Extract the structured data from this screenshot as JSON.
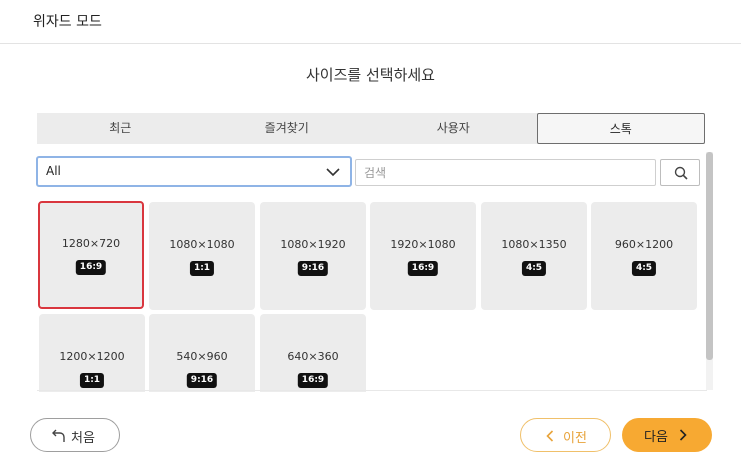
{
  "window": {
    "title": "위자드 모드"
  },
  "heading": "사이즈를 선택하세요",
  "tabs": [
    {
      "label": "최근",
      "active": false
    },
    {
      "label": "즐겨찾기",
      "active": false
    },
    {
      "label": "사용자",
      "active": false
    },
    {
      "label": "스톡",
      "active": true
    }
  ],
  "filter": {
    "selected": "All"
  },
  "search": {
    "placeholder": "검색",
    "value": ""
  },
  "sizes": [
    {
      "size": "1280×720",
      "ratio": "16:9",
      "selected": true
    },
    {
      "size": "1080×1080",
      "ratio": "1:1",
      "selected": false
    },
    {
      "size": "1080×1920",
      "ratio": "9:16",
      "selected": false
    },
    {
      "size": "1920×1080",
      "ratio": "16:9",
      "selected": false
    },
    {
      "size": "1080×1350",
      "ratio": "4:5",
      "selected": false
    },
    {
      "size": "960×1200",
      "ratio": "4:5",
      "selected": false
    },
    {
      "size": "1200×1200",
      "ratio": "1:1",
      "selected": false
    },
    {
      "size": "540×960",
      "ratio": "9:16",
      "selected": false
    },
    {
      "size": "640×360",
      "ratio": "16:9",
      "selected": false
    }
  ],
  "buttons": {
    "first": "처음",
    "prev": "이전",
    "next": "다음"
  },
  "colors": {
    "accent": "#f7a932",
    "selected_border": "#d9363e",
    "focus_border": "#8fb4e6"
  },
  "icons": {
    "first": "return-arrow-icon",
    "prev": "chevron-left-icon",
    "next": "chevron-right-icon",
    "search": "search-icon",
    "dropdown": "chevron-down-icon"
  }
}
